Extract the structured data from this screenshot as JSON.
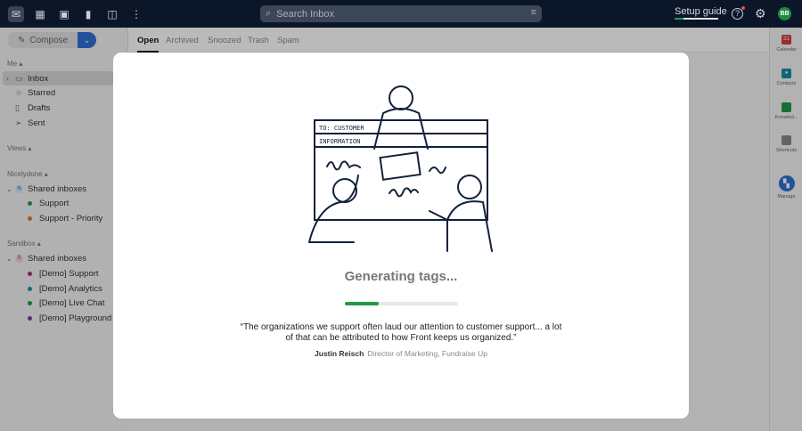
{
  "topbar": {
    "search_placeholder": "Search Inbox",
    "setup_guide": "Setup guide",
    "setup_progress": 0.2,
    "avatar_initials": "BB"
  },
  "compose": {
    "label": "Compose"
  },
  "sidebar": {
    "me": {
      "label": "Me ▴",
      "items": [
        {
          "label": "Inbox"
        },
        {
          "label": "Starred"
        },
        {
          "label": "Drafts"
        },
        {
          "label": "Sent"
        }
      ]
    },
    "views": "Views ▴",
    "nicelydone": {
      "label": "Nicelydone ▴",
      "group": "Shared inboxes",
      "badge": "N",
      "items": [
        {
          "label": "Support",
          "color": "#1f9a46"
        },
        {
          "label": "Support - Priority",
          "color": "#e07b28"
        }
      ]
    },
    "sandbox": {
      "label": "Sandbox ▴",
      "group": "Shared inboxes",
      "badge": "S",
      "items": [
        {
          "label": "[Demo] Support",
          "color": "#a0307d"
        },
        {
          "label": "[Demo] Analytics",
          "color": "#1a9aa0"
        },
        {
          "label": "[Demo] Live Chat",
          "color": "#1f9a46"
        },
        {
          "label": "[Demo] Playground",
          "color": "#7a3fa8"
        }
      ]
    }
  },
  "tabs": [
    "Open",
    "Archived",
    "Snoozed",
    "Trash",
    "Spam"
  ],
  "rail": [
    "Calendar",
    "Contacts",
    "Knowled...",
    "Shortcuts",
    "Manage"
  ],
  "modal": {
    "title": "Generating tags...",
    "progress": 0.3,
    "quote": "“The organizations we support often laud our attention to customer support... a lot of that can be attributed to how Front keeps us organized.”",
    "author": "Justin Reisch",
    "role": "Director of Marketing, Fundraise Up",
    "illustration_text": "TO: CUSTOMER INFORMATION"
  }
}
